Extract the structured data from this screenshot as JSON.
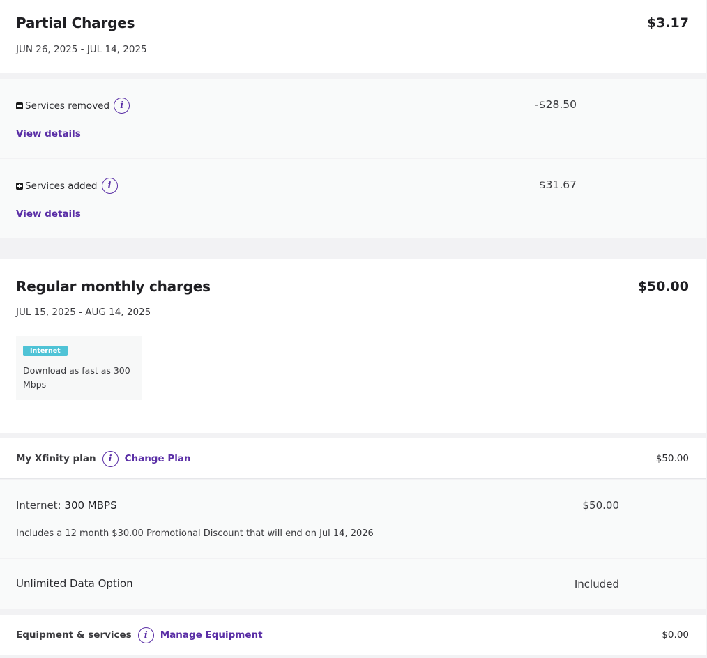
{
  "partial": {
    "title": "Partial Charges",
    "amount": "$3.17",
    "date_range": "JUN 26, 2025 - JUL 14, 2025"
  },
  "removed": {
    "label": "Services removed",
    "amount": "-$28.50",
    "link": "View details",
    "icon": "minus-square-icon"
  },
  "added": {
    "label": "Services added",
    "amount": "$31.67",
    "link": "View details",
    "icon": "plus-square-icon"
  },
  "regular": {
    "title": "Regular monthly charges",
    "amount": "$50.00",
    "date_range": "JUL 15, 2025 - AUG 14, 2025",
    "tile": {
      "tag": "Internet",
      "text": "Download as fast as 300 Mbps",
      "tag_color": "#4fc3d6"
    }
  },
  "plan": {
    "label": "My Xfinity plan",
    "link": "Change Plan",
    "amount": "$50.00"
  },
  "internet": {
    "prefix": "Internet:",
    "value": "300 MBPS",
    "amount": "$50.00",
    "note": "Includes a 12 month $30.00 Promotional Discount that will end on Jul 14, 2026"
  },
  "data_option": {
    "label": "Unlimited Data Option",
    "amount": "Included"
  },
  "equipment": {
    "label": "Equipment & services",
    "link": "Manage Equipment",
    "amount": "$0.00"
  },
  "info_glyph": "i",
  "colors": {
    "accent": "#5a2ea6",
    "tag": "#4fc3d6",
    "background": "#f2f2f4"
  }
}
